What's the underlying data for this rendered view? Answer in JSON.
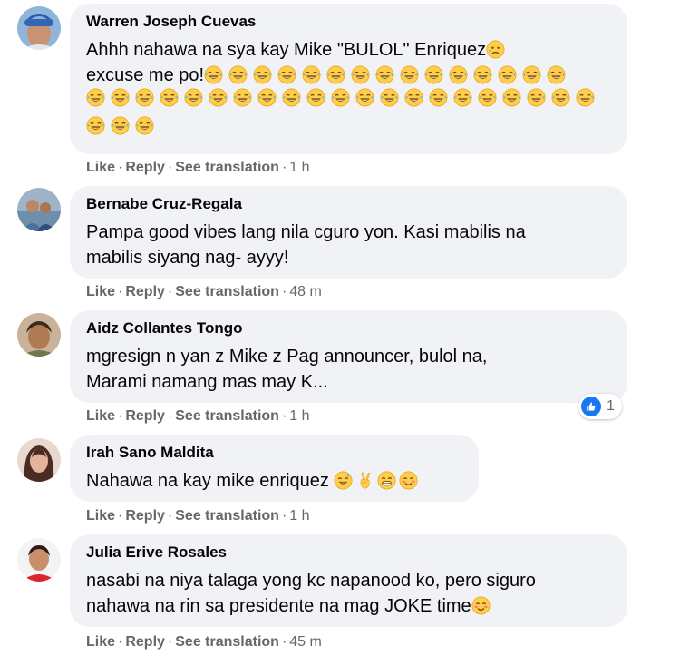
{
  "comments": [
    {
      "author": "Warren Joseph Cuevas",
      "line1": "Ahhh nahawa na sya kay Mike \"BULOL\" Enriquez",
      "line2": "excuse me po!",
      "like": "Like",
      "reply": "Reply",
      "translate": "See translation",
      "time": "1 h",
      "emoji_tail_line1": "worried-face-icon",
      "emoji_icon": "joy-face-icon",
      "emoji_counts": [
        15,
        21,
        3
      ]
    },
    {
      "author": "Bernabe Cruz-Regala",
      "line1": "Pampa good vibes lang nila cguro yon. Kasi mabilis na",
      "line2": "mabilis siyang nag- ayyy!",
      "like": "Like",
      "reply": "Reply",
      "translate": "See translation",
      "time": "48 m"
    },
    {
      "author": "Aidz Collantes Tongo",
      "line1": "mgresign n yan z Mike z Pag announcer, bulol na,",
      "line2": "Marami namang mas may K...",
      "like": "Like",
      "reply": "Reply",
      "translate": "See translation",
      "time": "1 h",
      "reaction_count": "1",
      "reaction_icon": "thumbs-up-icon"
    },
    {
      "author": "Irah Sano Maldita",
      "line1": "Nahawa na kay mike enriquez",
      "like": "Like",
      "reply": "Reply",
      "translate": "See translation",
      "time": "1 h",
      "emojis": [
        "sweat-smile-icon",
        "victory-hand-icon",
        "grin-icon",
        "blush-icon"
      ]
    },
    {
      "author": "Julia Erive Rosales",
      "line1": "nasabi na niya talaga yong kc napanood ko, pero siguro",
      "line2": "nahawa na rin sa presidente na mag JOKE time",
      "like": "Like",
      "reply": "Reply",
      "translate": "See translation",
      "time": "45 m",
      "emoji_tail_line2": "blush-icon"
    }
  ],
  "colors": {
    "bubble": "#f0f2f5",
    "meta_text": "#65676b",
    "like_blue": "#1877f2",
    "emoji_yellow": "#ffcc4d"
  }
}
